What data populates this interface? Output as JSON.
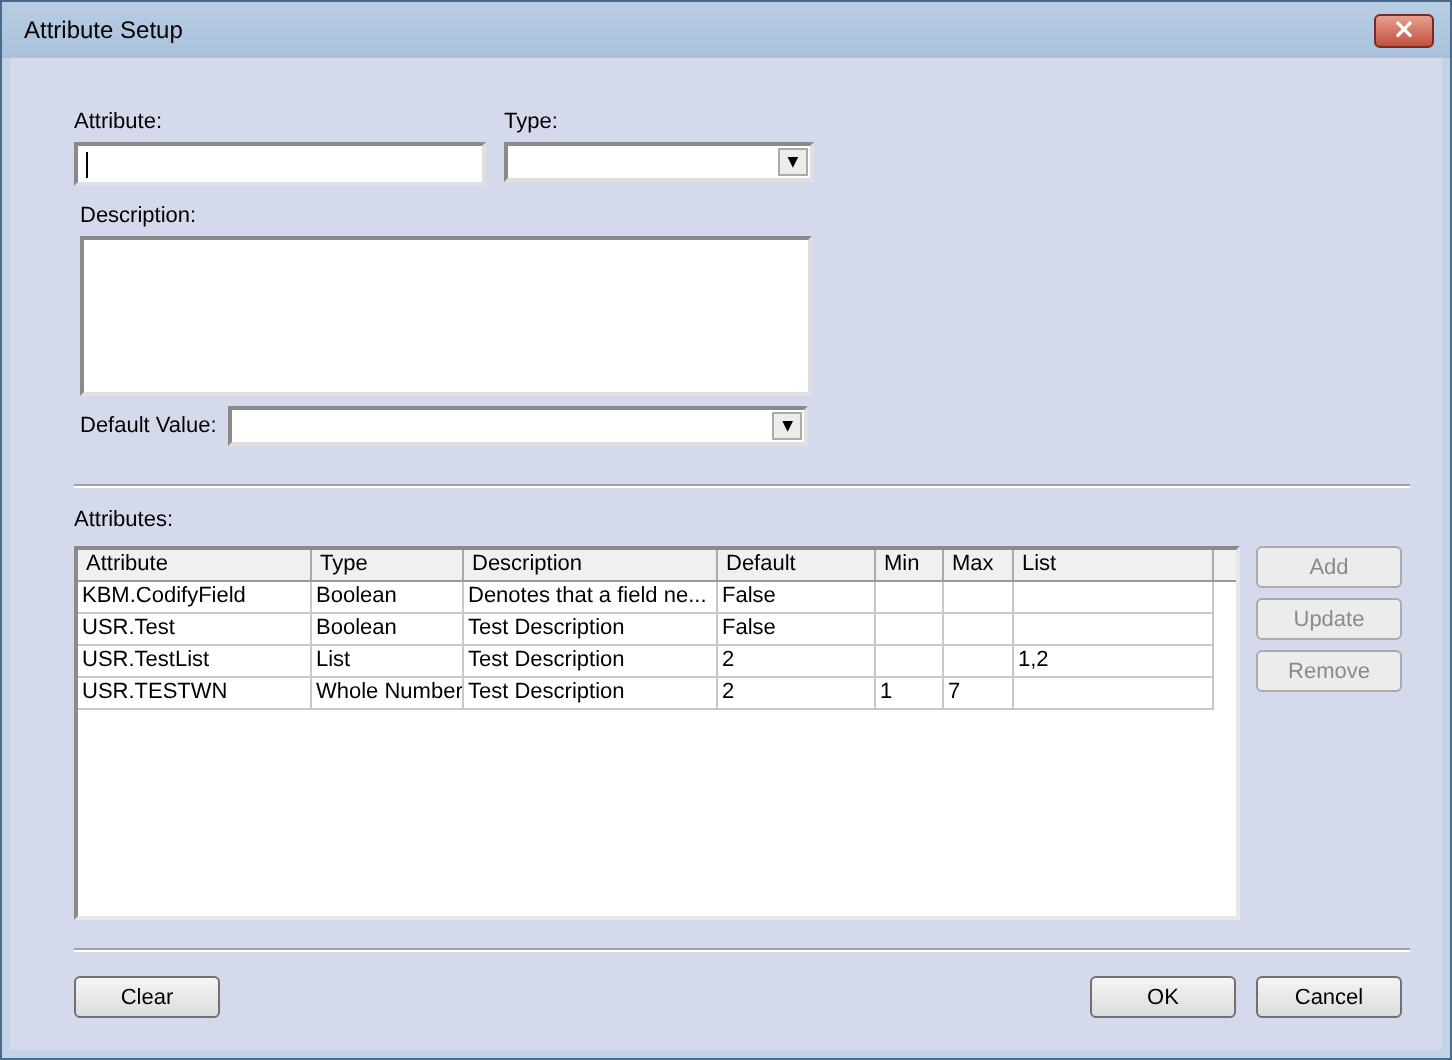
{
  "window": {
    "title": "Attribute Setup",
    "close": "×"
  },
  "form": {
    "attribute_label": "Attribute:",
    "type_label": "Type:",
    "description_label": "Description:",
    "default_label": "Default Value:",
    "dropdown_arrow": "▼"
  },
  "attributes_label": "Attributes:",
  "table": {
    "columns": [
      "Attribute",
      "Type",
      "Description",
      "Default",
      "Min",
      "Max",
      "List"
    ],
    "rows": [
      [
        "KBM.CodifyField",
        "Boolean",
        "Denotes that a field ne...",
        "False",
        "",
        "",
        ""
      ],
      [
        "USR.Test",
        "Boolean",
        "Test Description",
        "False",
        "",
        "",
        ""
      ],
      [
        "USR.TestList",
        "List",
        "Test Description",
        "2",
        "",
        "",
        "1,2"
      ],
      [
        "USR.TESTWN",
        "Whole Number",
        "Test Description",
        "2",
        "1",
        "7",
        ""
      ]
    ]
  },
  "side_buttons": [
    {
      "label": "Add",
      "disabled": true
    },
    {
      "label": "Update",
      "disabled": true
    },
    {
      "label": "Remove",
      "disabled": true
    }
  ],
  "footer_buttons": [
    {
      "label": "Clear",
      "kind": "left"
    },
    {
      "label": "OK",
      "kind": "right"
    },
    {
      "label": "Cancel",
      "kind": "right"
    }
  ]
}
